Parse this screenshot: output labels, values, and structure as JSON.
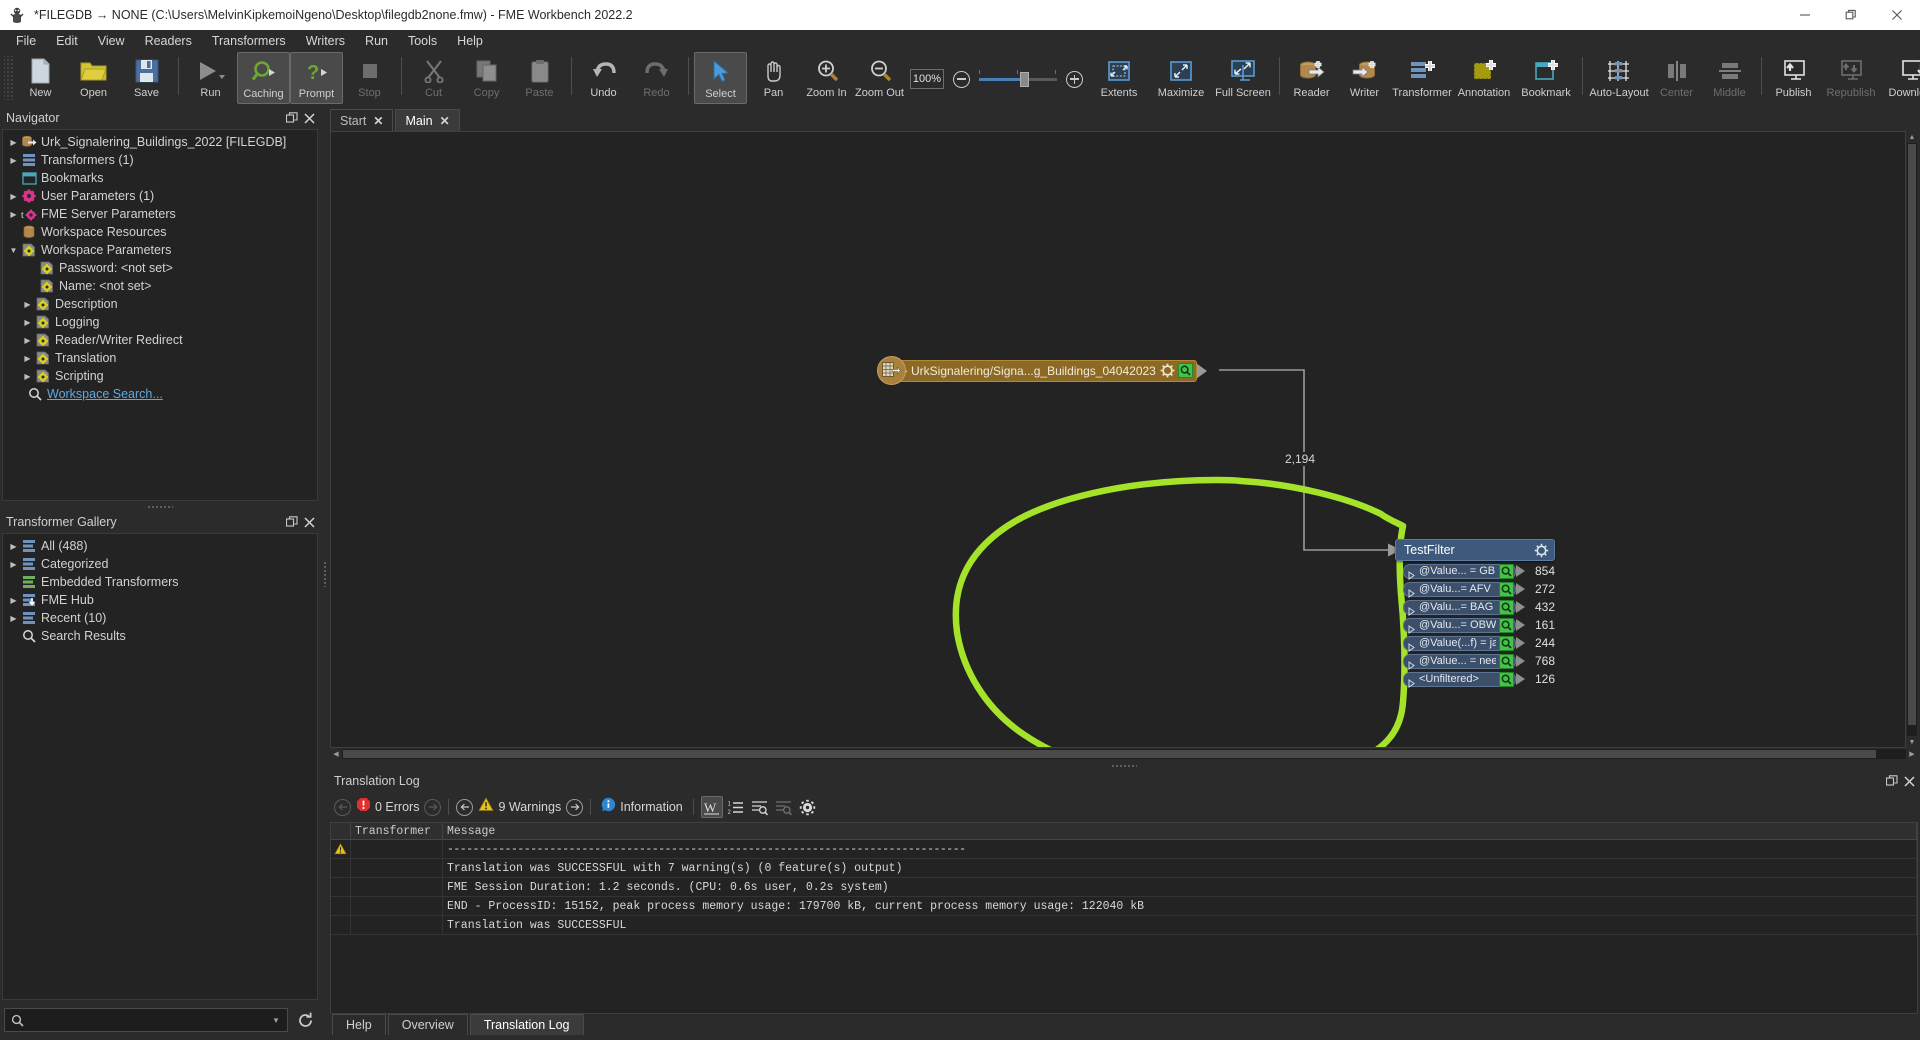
{
  "window": {
    "title": "*FILEGDB → NONE (C:\\Users\\MelvinKipkemoiNgeno\\Desktop\\filegdb2none.fmw) - FME Workbench 2022.2",
    "minimize": "—",
    "maximize": "❐",
    "close": "✕"
  },
  "menubar": [
    {
      "label": "File"
    },
    {
      "label": "Edit"
    },
    {
      "label": "View"
    },
    {
      "label": "Readers"
    },
    {
      "label": "Transformers"
    },
    {
      "label": "Writers"
    },
    {
      "label": "Run"
    },
    {
      "label": "Tools"
    },
    {
      "label": "Help"
    }
  ],
  "toolbar": {
    "zoom_value": "100%",
    "items": [
      {
        "label": "New",
        "icon": "new-file-icon",
        "state": "enabled"
      },
      {
        "label": "Open",
        "icon": "open-folder-icon",
        "state": "enabled"
      },
      {
        "label": "Save",
        "icon": "save-disk-icon",
        "state": "enabled"
      },
      {
        "label": "Run",
        "icon": "run-play-icon",
        "state": "enabled"
      },
      {
        "label": "Caching",
        "icon": "caching-magnifier-icon",
        "state": "active"
      },
      {
        "label": "Prompt",
        "icon": "prompt-question-icon",
        "state": "active"
      },
      {
        "label": "Stop",
        "icon": "stop-square-icon",
        "state": "disabled"
      },
      {
        "label": "Cut",
        "icon": "scissors-icon",
        "state": "disabled"
      },
      {
        "label": "Copy",
        "icon": "copy-icon",
        "state": "disabled"
      },
      {
        "label": "Paste",
        "icon": "clipboard-icon",
        "state": "disabled"
      },
      {
        "label": "Undo",
        "icon": "undo-arrow-icon",
        "state": "enabled"
      },
      {
        "label": "Redo",
        "icon": "redo-arrow-icon",
        "state": "disabled"
      },
      {
        "label": "Select",
        "icon": "cursor-arrow-icon",
        "state": "active"
      },
      {
        "label": "Pan",
        "icon": "hand-icon",
        "state": "enabled"
      },
      {
        "label": "Zoom In",
        "icon": "zoom-in-icon",
        "state": "enabled"
      },
      {
        "label": "Zoom Out",
        "icon": "zoom-out-icon",
        "state": "enabled"
      },
      {
        "label": "Extents",
        "icon": "extents-icon",
        "state": "enabled"
      },
      {
        "label": "Maximize",
        "icon": "maximize-icon",
        "state": "enabled"
      },
      {
        "label": "Full Screen",
        "icon": "full-screen-icon",
        "state": "enabled"
      },
      {
        "label": "Reader",
        "icon": "add-reader-icon",
        "state": "enabled"
      },
      {
        "label": "Writer",
        "icon": "add-writer-icon",
        "state": "enabled"
      },
      {
        "label": "Transformer",
        "icon": "add-transformer-icon",
        "state": "enabled"
      },
      {
        "label": "Annotation",
        "icon": "add-annotation-icon",
        "state": "enabled"
      },
      {
        "label": "Bookmark",
        "icon": "add-bookmark-icon",
        "state": "enabled"
      },
      {
        "label": "Auto-Layout",
        "icon": "auto-layout-icon",
        "state": "enabled"
      },
      {
        "label": "Center",
        "icon": "align-center-icon",
        "state": "disabled"
      },
      {
        "label": "Middle",
        "icon": "align-middle-icon",
        "state": "disabled"
      },
      {
        "label": "Publish",
        "icon": "publish-icon",
        "state": "enabled"
      },
      {
        "label": "Republish",
        "icon": "republish-icon",
        "state": "disabled"
      },
      {
        "label": "Download",
        "icon": "download-icon",
        "state": "enabled"
      }
    ]
  },
  "navigator": {
    "title": "Navigator",
    "items": [
      {
        "label": "Urk_Signalering_Buildings_2022 [FILEGDB]",
        "icon": "reader-dataset-icon",
        "indent": 0,
        "expandable": true,
        "expanded": false
      },
      {
        "label": "Transformers (1)",
        "icon": "transformer-icon",
        "indent": 0,
        "expandable": true,
        "expanded": false
      },
      {
        "label": "Bookmarks",
        "icon": "bookmark-icon",
        "indent": 0,
        "expandable": false,
        "expanded": false
      },
      {
        "label": "User Parameters (1)",
        "icon": "user-param-gear-icon",
        "indent": 0,
        "expandable": true,
        "expanded": false
      },
      {
        "label": "FME Server Parameters",
        "icon": "server-param-icon",
        "indent": 0,
        "expandable": true,
        "expanded": false
      },
      {
        "label": "Workspace Resources",
        "icon": "resources-icon",
        "indent": 0,
        "expandable": false,
        "expanded": false
      },
      {
        "label": "Workspace Parameters",
        "icon": "workspace-param-icon",
        "indent": 0,
        "expandable": true,
        "expanded": true
      },
      {
        "label": "Password: <not set>",
        "icon": "param-gear-icon",
        "indent": 1,
        "expandable": false,
        "expanded": false
      },
      {
        "label": "Name: <not set>",
        "icon": "param-gear-icon",
        "indent": 1,
        "expandable": false,
        "expanded": false
      },
      {
        "label": "Description",
        "icon": "param-gear-icon",
        "indent": 1,
        "expandable": true,
        "expanded": false
      },
      {
        "label": "Logging",
        "icon": "param-gear-icon",
        "indent": 1,
        "expandable": true,
        "expanded": false
      },
      {
        "label": "Reader/Writer Redirect",
        "icon": "param-gear-icon",
        "indent": 1,
        "expandable": true,
        "expanded": false
      },
      {
        "label": "Translation",
        "icon": "param-gear-icon",
        "indent": 1,
        "expandable": true,
        "expanded": false
      },
      {
        "label": "Scripting",
        "icon": "param-gear-icon",
        "indent": 1,
        "expandable": true,
        "expanded": false
      },
      {
        "label": "Workspace Search...",
        "icon": "search-icon",
        "indent": 0,
        "expandable": false,
        "expanded": false,
        "link": true
      }
    ]
  },
  "gallery": {
    "title": "Transformer Gallery",
    "items": [
      {
        "label": "All (488)",
        "icon": "transformer-icon",
        "expandable": true
      },
      {
        "label": "Categorized",
        "icon": "transformer-icon",
        "expandable": true
      },
      {
        "label": "Embedded Transformers",
        "icon": "embedded-transformer-icon",
        "expandable": false
      },
      {
        "label": "FME Hub",
        "icon": "fme-hub-icon",
        "expandable": true
      },
      {
        "label": "Recent (10)",
        "icon": "transformer-icon",
        "expandable": true
      },
      {
        "label": "Search Results",
        "icon": "search-icon",
        "expandable": false
      }
    ],
    "search_placeholder": "",
    "search_value": ""
  },
  "canvas": {
    "tabs": [
      {
        "label": "Start",
        "active": false
      },
      {
        "label": "Main",
        "active": true
      }
    ],
    "reader_node": {
      "label": "UrkSignalering/Signa...g_Buildings_04042023",
      "icon": "feature-type-icon"
    },
    "connection_count": "2,194",
    "transformer": {
      "name": "TestFilter",
      "gear_icon": "gear-icon",
      "ports": [
        {
          "label": "@Value... = GBI",
          "count": "854"
        },
        {
          "label": "@Valu...= AFV",
          "count": "272"
        },
        {
          "label": "@Valu...= BAG",
          "count": "432"
        },
        {
          "label": "@Valu...= OBW",
          "count": "161"
        },
        {
          "label": "@Value(...f) = ja",
          "count": "244"
        },
        {
          "label": "@Value... = nee",
          "count": "768"
        },
        {
          "label": "<Unfiltered>",
          "count": "126"
        }
      ]
    },
    "annotation_color": "#a4e32a"
  },
  "log": {
    "title": "Translation Log",
    "errors_label": "0 Errors",
    "warnings_label": "9 Warnings",
    "information_label": "Information",
    "columns": [
      "",
      "Transformer",
      "Message"
    ],
    "rows": [
      {
        "icon": "warning-icon",
        "transformer": "",
        "message": "---------------------------------------------------------------------------------",
        "dashed": true
      },
      {
        "icon": "",
        "transformer": "",
        "message": "Translation was SUCCESSFUL with 7 warning(s) (0 feature(s) output)"
      },
      {
        "icon": "",
        "transformer": "",
        "message": "FME Session Duration: 1.2 seconds. (CPU: 0.6s user, 0.2s system)"
      },
      {
        "icon": "",
        "transformer": "",
        "message": "END - ProcessID: 15152, peak process memory usage: 179700 kB, current process memory usage: 122040 kB"
      },
      {
        "icon": "",
        "transformer": "",
        "message": "Translation was SUCCESSFUL"
      }
    ],
    "tabs": [
      {
        "label": "Help",
        "active": false
      },
      {
        "label": "Overview",
        "active": false
      },
      {
        "label": "Translation Log",
        "active": true
      }
    ]
  }
}
